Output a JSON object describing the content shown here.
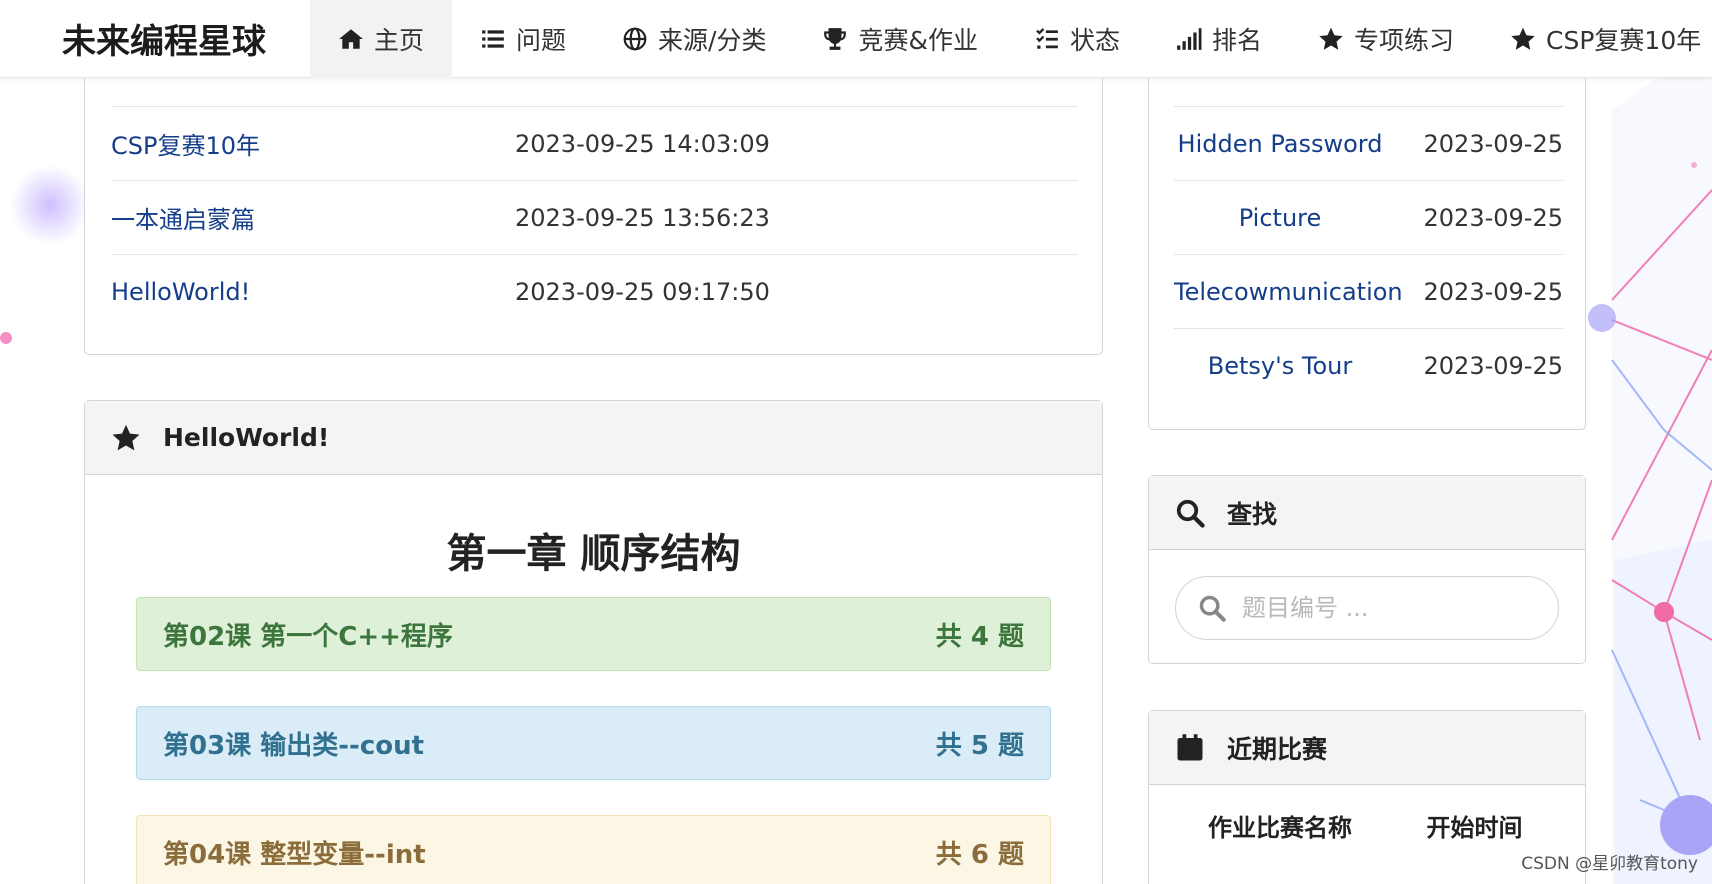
{
  "brand": "未来编程星球",
  "nav": [
    {
      "label": "主页",
      "icon": "home-icon",
      "active": true
    },
    {
      "label": "问题",
      "icon": "list-icon"
    },
    {
      "label": "来源/分类",
      "icon": "globe-icon"
    },
    {
      "label": "竞赛&作业",
      "icon": "trophy-icon"
    },
    {
      "label": "状态",
      "icon": "tasks-icon"
    },
    {
      "label": "排名",
      "icon": "signal-icon"
    },
    {
      "label": "专项练习",
      "icon": "star-icon"
    },
    {
      "label": "CSP复赛10年",
      "icon": "star-icon"
    }
  ],
  "recent_list": {
    "rows": [
      {
        "title": "CSP复赛10年",
        "time": "2023-09-25 14:03:09"
      },
      {
        "title": "一本通启蒙篇",
        "time": "2023-09-25 13:56:23"
      },
      {
        "title": "HelloWorld!",
        "time": "2023-09-25 09:17:50"
      }
    ]
  },
  "helloworld_card": {
    "title": "HelloWorld!",
    "chapter": "第一章 顺序结构",
    "lessons": [
      {
        "name": "第02课 第一个C++程序",
        "count": "共 4 题",
        "color": "green"
      },
      {
        "name": "第03课 输出类--cout",
        "count": "共 5 题",
        "color": "blue"
      },
      {
        "name": "第04课 整型变量--int",
        "count": "共 6 题",
        "color": "yellow"
      }
    ]
  },
  "right_list": {
    "rows": [
      {
        "title": "Hidden Password",
        "date": "2023-09-25"
      },
      {
        "title": "Picture",
        "date": "2023-09-25"
      },
      {
        "title": "Telecowmunication",
        "date": "2023-09-25"
      },
      {
        "title": "Betsy's Tour",
        "date": "2023-09-25"
      }
    ]
  },
  "search_card": {
    "title": "查找",
    "placeholder": "题目编号 ..."
  },
  "contest_card": {
    "title": "近期比赛",
    "col_name": "作业比赛名称",
    "col_time": "开始时间"
  },
  "watermark": "CSDN @星卯教育tony",
  "colors": {
    "link": "#153e8a",
    "green_bg": "#dff0d8",
    "blue_bg": "#d9ecf7",
    "yellow_bg": "#fcf6e4"
  }
}
